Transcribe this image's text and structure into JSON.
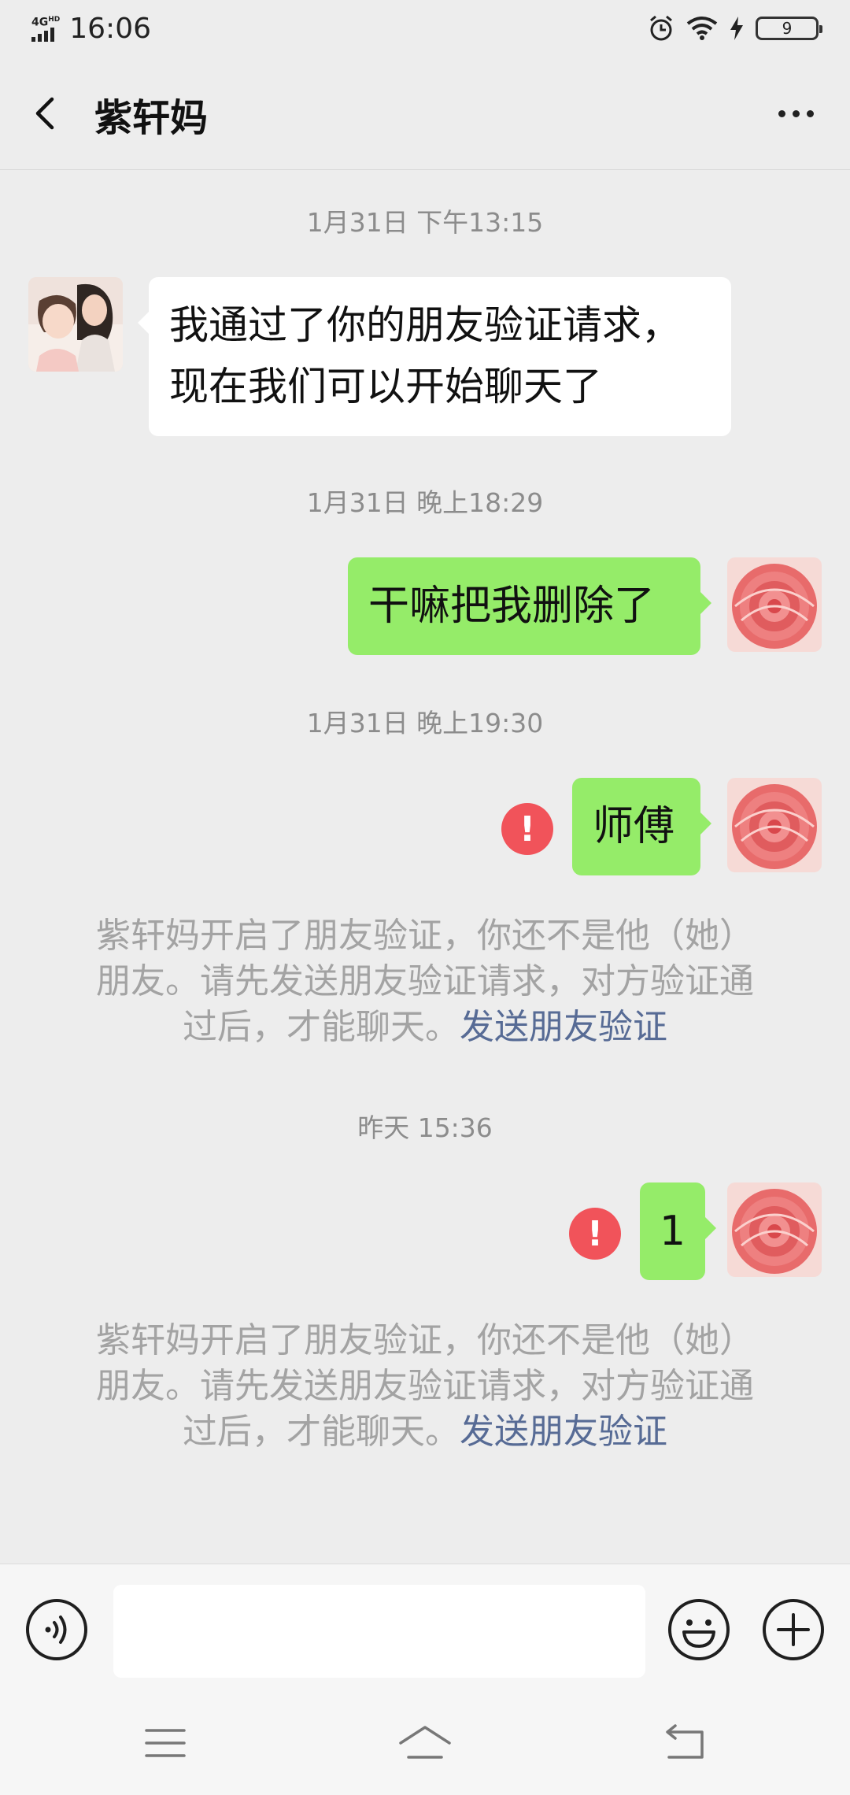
{
  "status_bar": {
    "network": "4G",
    "network_sup": "HD",
    "time": "16:06",
    "battery": "9"
  },
  "header": {
    "title": "紫轩妈"
  },
  "messages": [
    {
      "type": "timestamp",
      "text": "1月31日 下午13:15"
    },
    {
      "type": "received",
      "line1": "我通过了你的朋友验证请求，",
      "line2": "现在我们可以开始聊天了"
    },
    {
      "type": "timestamp",
      "text": "1月31日 晚上18:29"
    },
    {
      "type": "sent",
      "text": "干嘛把我删除了"
    },
    {
      "type": "timestamp",
      "text": "1月31日 晚上19:30"
    },
    {
      "type": "sent",
      "text": "师傅",
      "failed": true
    },
    {
      "type": "system",
      "line1": "紫轩妈开启了朋友验证，你还不是他（她）",
      "line2": "朋友。请先发送朋友验证请求，对方验证通",
      "line3": "过后，才能聊天。",
      "link": "发送朋友验证"
    },
    {
      "type": "timestamp",
      "text": "昨天 15:36"
    },
    {
      "type": "sent",
      "text": "1",
      "failed": true
    },
    {
      "type": "system",
      "line1": "紫轩妈开启了朋友验证，你还不是他（她）",
      "line2": "朋友。请先发送朋友验证请求，对方验证通",
      "line3": "过后，才能聊天。",
      "link": "发送朋友验证"
    }
  ],
  "input_bar": {
    "placeholder": ""
  },
  "colors": {
    "background": "#ededed",
    "sent_bubble": "#95ec69",
    "received_bubble": "#ffffff",
    "error_badge": "#f1535a",
    "link": "#576b95"
  },
  "icons": [
    "back-icon",
    "more-icon",
    "voice-icon",
    "emoji-icon",
    "plus-icon",
    "menu-icon",
    "home-icon",
    "return-icon",
    "alarm-icon",
    "wifi-icon",
    "charging-icon"
  ]
}
